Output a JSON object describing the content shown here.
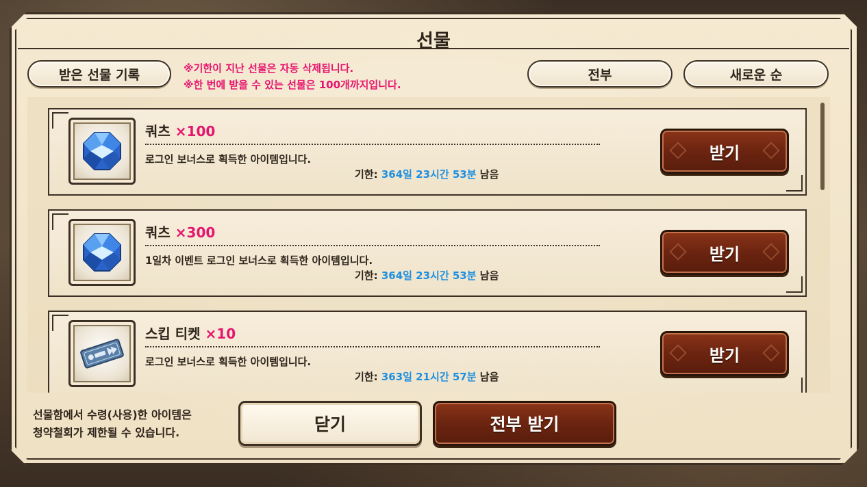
{
  "dialog": {
    "title": "선물"
  },
  "toolbar": {
    "history_label": "받은 선물 기록",
    "notice_line1": "※기한이 지난 선물은 자동 삭제됩니다.",
    "notice_line2": "※한 번에 받을 수 있는 선물은 100개까지입니다.",
    "filter_label": "전부",
    "sort_label": "새로운 순"
  },
  "gifts": [
    {
      "name": "쿼츠",
      "qty": "×100",
      "icon": "quartz-gem-icon",
      "description": "로그인 보너스로 획득한 아이템입니다.",
      "expiry_prefix": "기한: ",
      "expiry_time": "364일 23시간 53분",
      "expiry_suffix": " 남음",
      "claim_label": "받기"
    },
    {
      "name": "쿼츠",
      "qty": "×300",
      "icon": "quartz-gem-icon",
      "description": "1일차 이벤트 로그인 보너스로 획득한 아이템입니다.",
      "expiry_prefix": "기한: ",
      "expiry_time": "364일 23시간 53분",
      "expiry_suffix": " 남음",
      "claim_label": "받기"
    },
    {
      "name": "스킵 티켓",
      "qty": "×10",
      "icon": "skip-ticket-icon",
      "description": "로그인 보너스로 획득한 아이템입니다.",
      "expiry_prefix": "기한: ",
      "expiry_time": "363일 21시간 57분",
      "expiry_suffix": " 남음",
      "claim_label": "받기"
    }
  ],
  "footer": {
    "note_line1": "선물함에서 수령(사용)한 아이템은",
    "note_line2": "청약철회가 제한될 수 있습니다.",
    "close_label": "닫기",
    "claim_all_label": "전부 받기"
  },
  "colors": {
    "accent_pink": "#e6146e",
    "time_blue": "#1e8fe0",
    "button_brown": "#6b2410",
    "parchment": "#f3e6cb"
  }
}
